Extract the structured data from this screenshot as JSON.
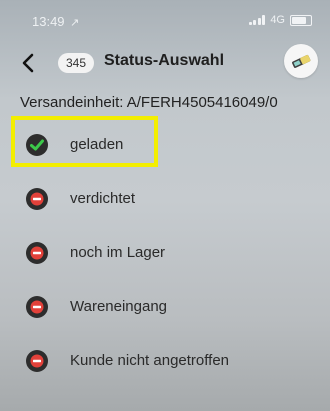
{
  "status_bar": {
    "time": "13:49",
    "location_icon": "location-arrow-icon",
    "network": "4G"
  },
  "nav": {
    "badge": "345",
    "title": "Status-Auswahl"
  },
  "shipment_label": "Versandeinheit: A/FERH4505416049/0",
  "statuses": [
    {
      "label": "geladen",
      "state": "selected",
      "icon": "check-icon"
    },
    {
      "label": "verdichtet",
      "state": "unselected",
      "icon": "minus-circle-icon"
    },
    {
      "label": "noch im Lager",
      "state": "unselected",
      "icon": "minus-circle-icon"
    },
    {
      "label": "Wareneingang",
      "state": "unselected",
      "icon": "minus-circle-icon"
    },
    {
      "label": "Kunde nicht angetroffen",
      "state": "unselected",
      "icon": "minus-circle-icon"
    }
  ],
  "colors": {
    "highlight": "#f3ee00",
    "check": "#3cc84a",
    "no_entry": "#e2413a",
    "circle": "#2d2d2d"
  }
}
